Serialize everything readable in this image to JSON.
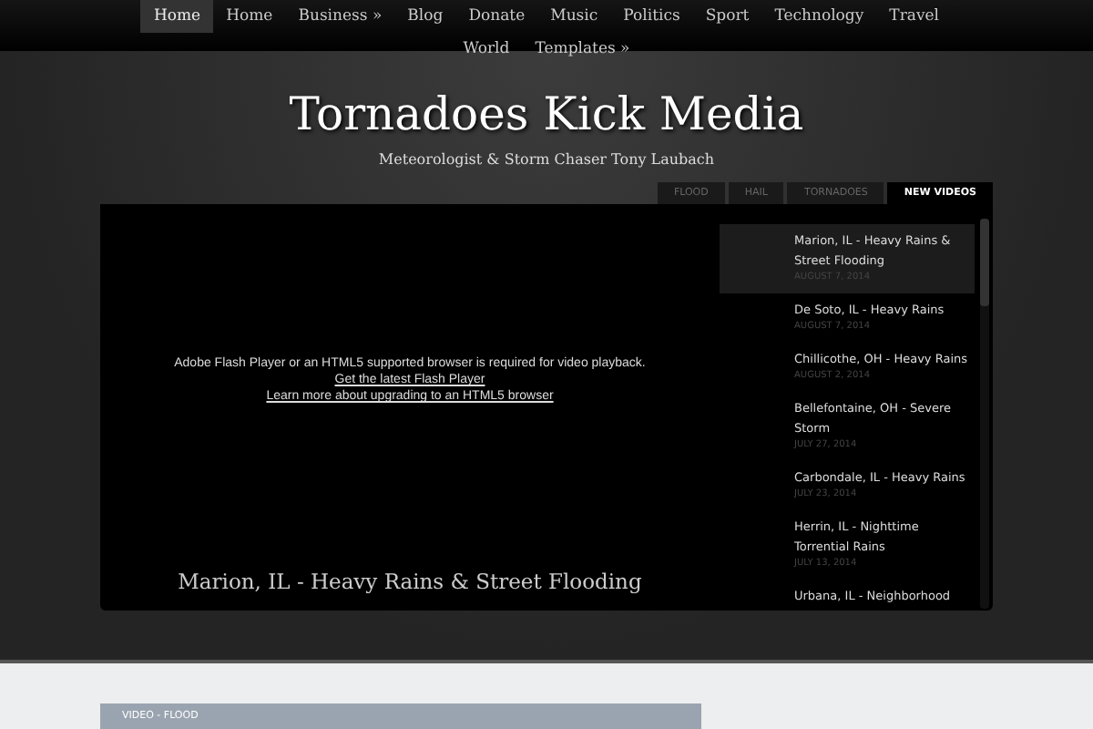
{
  "nav": [
    {
      "label": "Home",
      "selected": true
    },
    {
      "label": "Home",
      "selected": false
    },
    {
      "label": "Business »",
      "selected": false
    },
    {
      "label": "Blog",
      "selected": false
    },
    {
      "label": "Donate",
      "selected": false
    },
    {
      "label": "Music",
      "selected": false
    },
    {
      "label": "Politics",
      "selected": false
    },
    {
      "label": "Sport",
      "selected": false
    },
    {
      "label": "Technology",
      "selected": false
    },
    {
      "label": "Travel",
      "selected": false
    },
    {
      "label": "World",
      "selected": false
    },
    {
      "label": "Templates »",
      "selected": false
    }
  ],
  "site": {
    "title": "Tornadoes Kick Media",
    "tagline": "Meteorologist & Storm Chaser Tony Laubach"
  },
  "tabs": [
    {
      "label": "FLOOD",
      "selected": false
    },
    {
      "label": "HAIL",
      "selected": false
    },
    {
      "label": "TORNADOES",
      "selected": false
    },
    {
      "label": "NEW VIDEOS",
      "selected": true
    }
  ],
  "player": {
    "message": "Adobe Flash Player or an HTML5 supported browser is required for video playback.",
    "links": [
      "Get the latest Flash Player",
      "Learn more about upgrading to an HTML5 browser"
    ],
    "caption": "Marion, IL - Heavy Rains & Street Flooding"
  },
  "videos": [
    {
      "title": "Marion, IL - Heavy Rains & Street Flooding",
      "date": "AUGUST 7, 2014",
      "selected": true
    },
    {
      "title": "De Soto, IL - Heavy Rains",
      "date": "AUGUST 7, 2014",
      "selected": false
    },
    {
      "title": "Chillicothe, OH - Heavy Rains",
      "date": "AUGUST 2, 2014",
      "selected": false
    },
    {
      "title": "Bellefontaine, OH - Severe Storm",
      "date": "JULY 27, 2014",
      "selected": false
    },
    {
      "title": "Carbondale, IL - Heavy Rains",
      "date": "JULY 23, 2014",
      "selected": false
    },
    {
      "title": "Herrin, IL - Nighttime Torrential Rains",
      "date": "JULY 13, 2014",
      "selected": false
    },
    {
      "title": "Urbana, IL - Neighborhood",
      "selected": false
    }
  ],
  "section": {
    "label": "VIDEO - FLOOD"
  }
}
